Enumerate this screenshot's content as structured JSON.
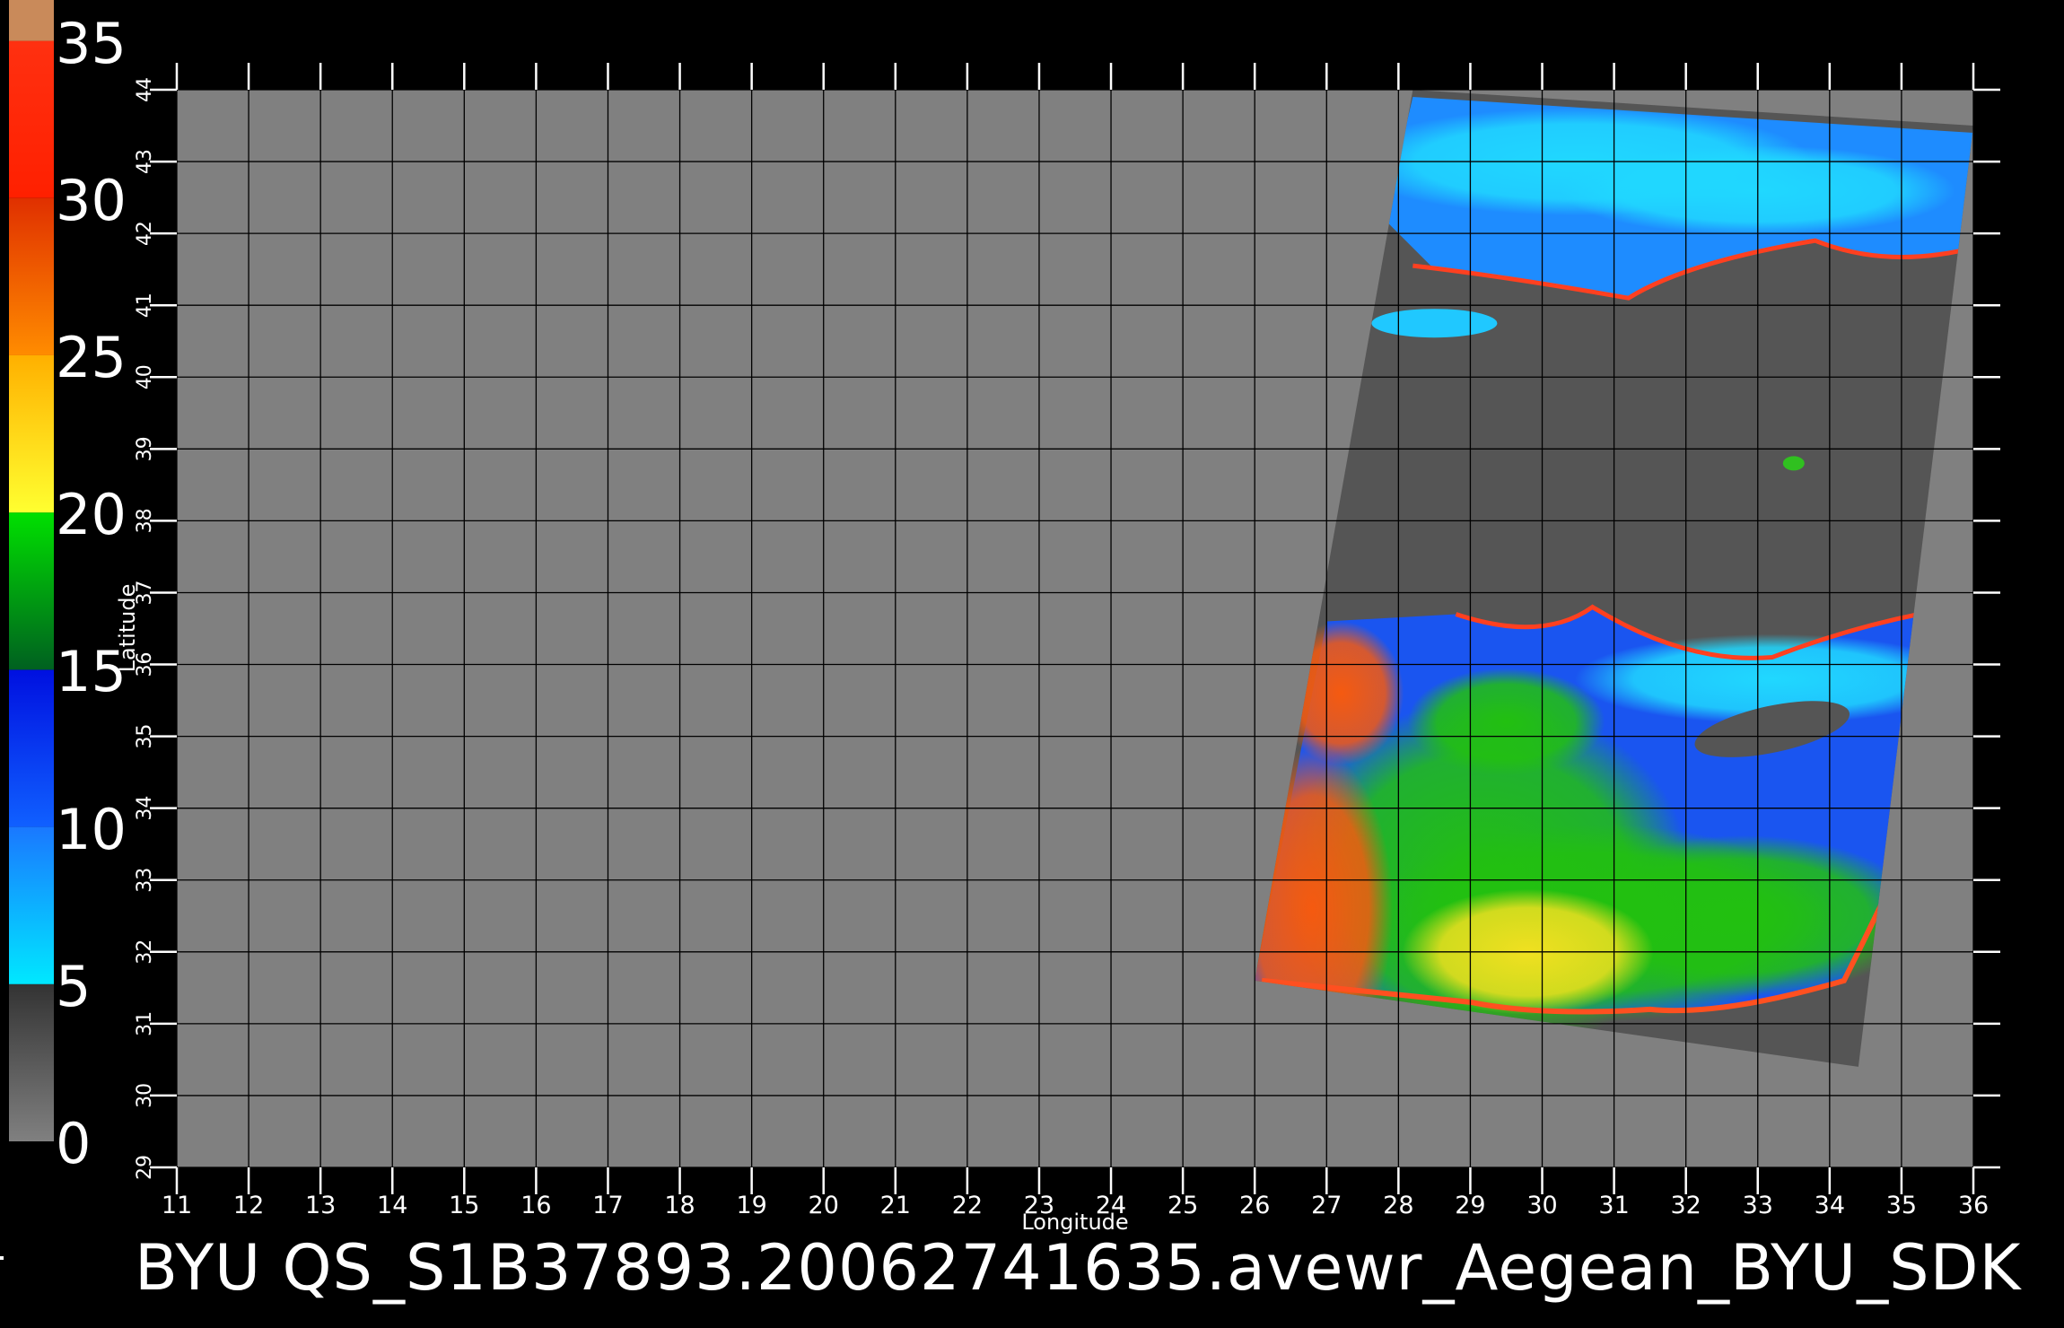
{
  "colorbar": {
    "labels": [
      "35",
      "30",
      "25",
      "20",
      "15",
      "10",
      "5",
      "0"
    ],
    "segments": [
      {
        "from": 0,
        "to": 5,
        "colors": [
          "#808080",
          "#333333"
        ]
      },
      {
        "from": 5,
        "to": 10,
        "colors": [
          "#00e8ff",
          "#1a78ff"
        ]
      },
      {
        "from": 10,
        "to": 15,
        "colors": [
          "#1060ff",
          "#0010e0"
        ]
      },
      {
        "from": 15,
        "to": 20,
        "colors": [
          "#006020",
          "#00e000"
        ]
      },
      {
        "from": 20,
        "to": 25,
        "colors": [
          "#ffff30",
          "#ffb000"
        ]
      },
      {
        "from": 25,
        "to": 30,
        "colors": [
          "#ff8c00",
          "#e03000"
        ]
      },
      {
        "from": 30,
        "to": 35,
        "colors": [
          "#ff2000",
          "#ff3010"
        ]
      },
      {
        "from": 35,
        "to": 36.3,
        "colors": [
          "#c98a5a",
          "#c98a5a"
        ]
      }
    ]
  },
  "chart_data": {
    "type": "heatmap",
    "xlabel": "Longitude",
    "ylabel": "Latitude",
    "xlim": [
      11,
      36
    ],
    "ylim": [
      29,
      44
    ],
    "x_ticks": [
      "11",
      "12",
      "13",
      "14",
      "15",
      "16",
      "17",
      "18",
      "19",
      "20",
      "21",
      "22",
      "23",
      "24",
      "25",
      "26",
      "27",
      "28",
      "29",
      "30",
      "31",
      "32",
      "33",
      "34",
      "35",
      "36"
    ],
    "y_ticks": [
      "29",
      "30",
      "31",
      "32",
      "33",
      "34",
      "35",
      "36",
      "37",
      "38",
      "39",
      "40",
      "41",
      "42",
      "43",
      "44"
    ],
    "grid": true,
    "background_color": "#808080",
    "swath_color": "#555555",
    "swath_corners_lonlat": [
      [
        28.2,
        44
      ],
      [
        36,
        43.5
      ],
      [
        34.4,
        30.4
      ],
      [
        26,
        31.6
      ]
    ]
  },
  "title": "BYU  QS_S1B37893.20062741635.avewr_Aegean_BYU_SDK"
}
